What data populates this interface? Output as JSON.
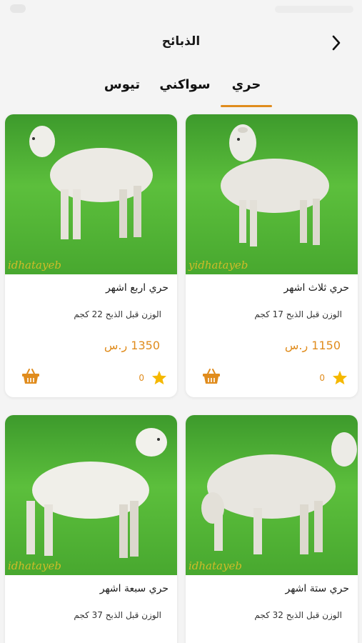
{
  "header": {
    "title": "الذبائح",
    "back_icon": "chevron-right-icon"
  },
  "tabs": [
    {
      "label": "حري",
      "active": true
    },
    {
      "label": "سواكني",
      "active": false
    },
    {
      "label": "تيوس",
      "active": false
    }
  ],
  "products": [
    {
      "name": "حري ثلاث اشهر",
      "weight": "الوزن قبل الذبح 17 كجم",
      "price": "1150 ر.س",
      "rating_count": "0",
      "watermark": "yidhatayeb"
    },
    {
      "name": "حري اربع اشهر",
      "weight": "الوزن قبل الذبح 22 كجم",
      "price": "1350 ر.س",
      "rating_count": "0",
      "watermark": "idhatayeb"
    },
    {
      "name": "حري ستة اشهر",
      "weight": "الوزن قبل الذبح 32 كجم",
      "price": "",
      "rating_count": "",
      "watermark": "idhatayeb"
    },
    {
      "name": "حري سبعة اشهر",
      "weight": "الوزن قبل الذبح 37 كجم",
      "price": "",
      "rating_count": "",
      "watermark": "idhatayeb"
    }
  ],
  "colors": {
    "accent": "#e08c1d",
    "grass": "#4caf34",
    "background": "#f4f4f4",
    "star": "#f5b800"
  }
}
